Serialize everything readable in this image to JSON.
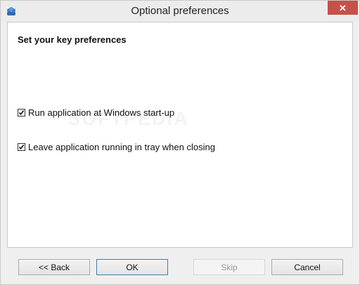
{
  "window": {
    "title": "Optional preferences",
    "app_icon": "cloud-people-icon",
    "close_icon": "close-icon"
  },
  "content": {
    "heading": "Set your key preferences",
    "options": [
      {
        "label": "Run application at Windows start-up",
        "checked": true
      },
      {
        "label": "Leave application running in tray when closing",
        "checked": true
      }
    ],
    "watermark": "SOFTPEDIA"
  },
  "footer": {
    "back_label": "<< Back",
    "ok_label": "OK",
    "skip_label": "Skip",
    "cancel_label": "Cancel"
  }
}
